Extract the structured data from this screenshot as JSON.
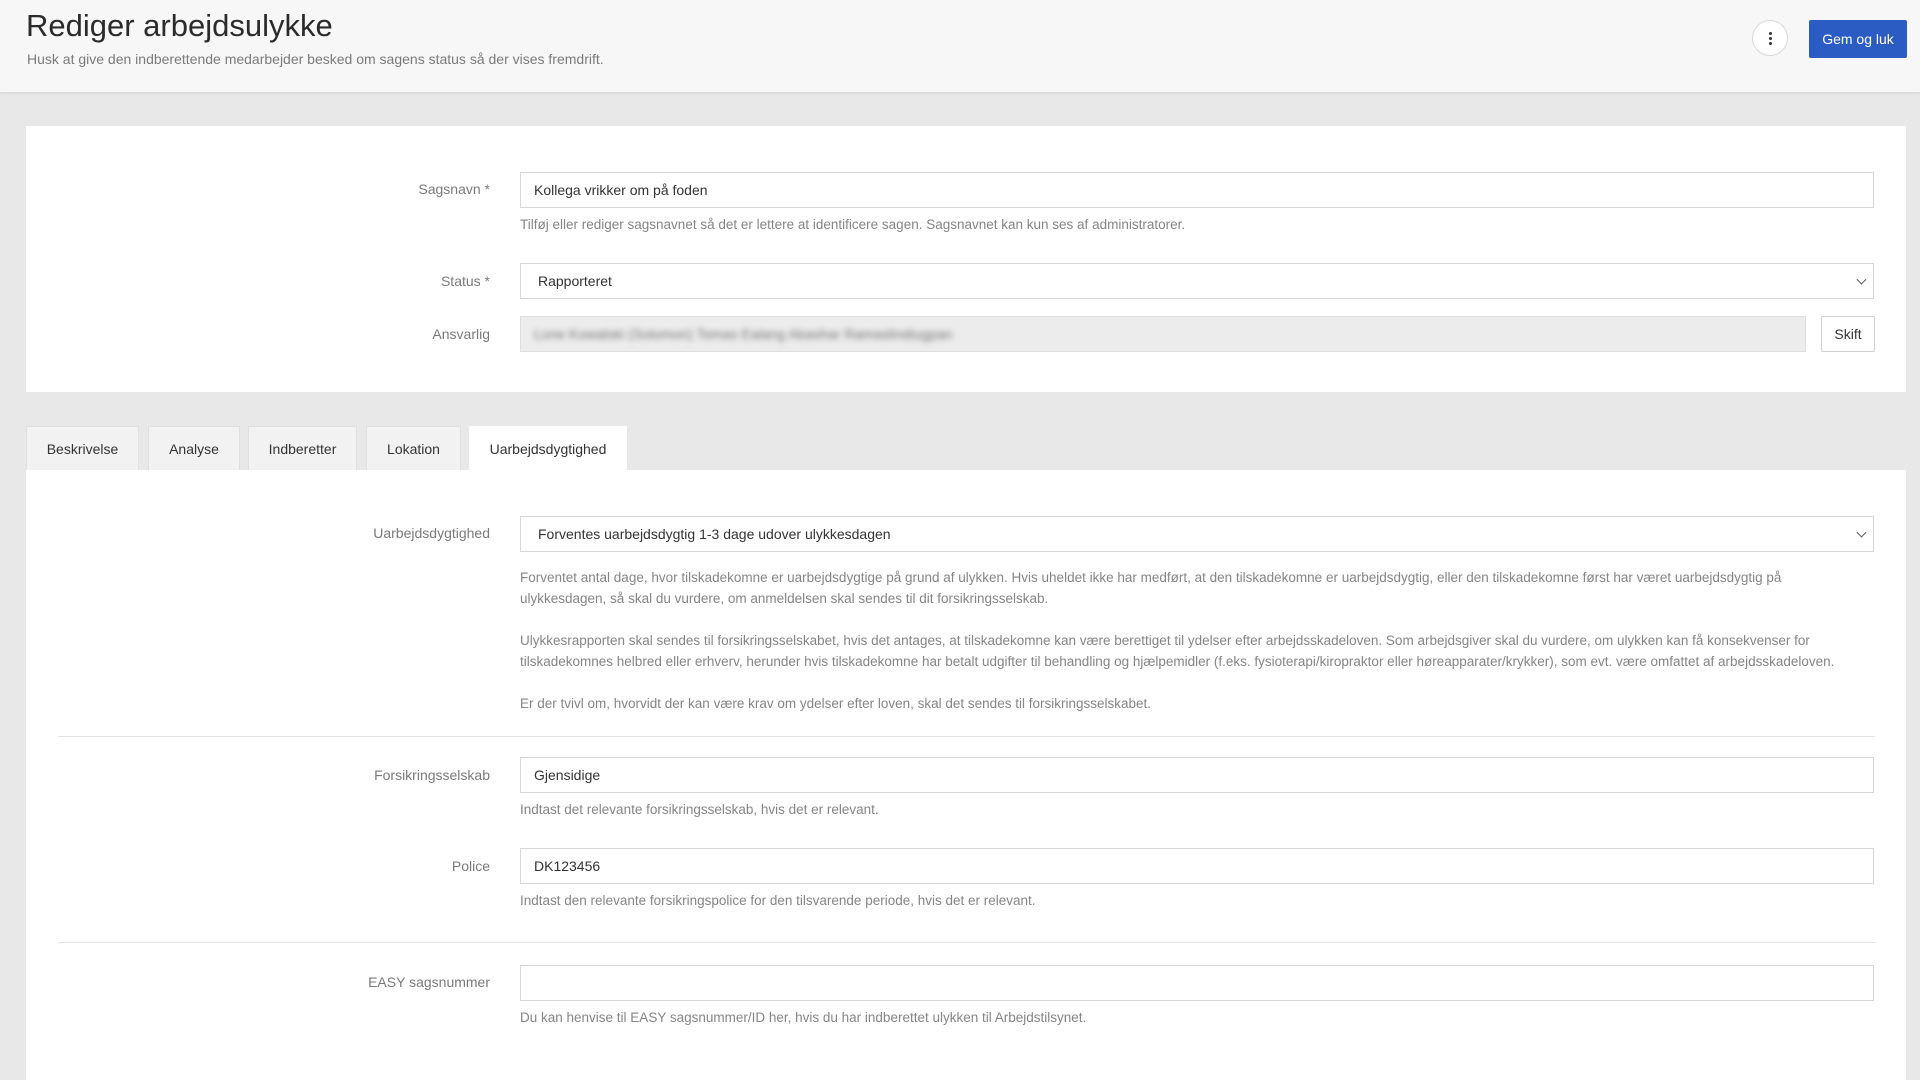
{
  "header": {
    "title": "Rediger arbejdsulykke",
    "subtitle": "Husk at give den indberettende medarbejder besked om sagens status så der vises fremdrift.",
    "save_label": "Gem og luk",
    "more_icon": "more-vertical-icon"
  },
  "case_fields": {
    "case_name": {
      "label": "Sagsnavn *",
      "value": "Kollega vrikker om på foden",
      "help": "Tilføj eller rediger sagsnavnet så det er lettere at identificere sagen. Sagsnavnet kan kun ses af administratorer."
    },
    "status": {
      "label": "Status *",
      "value": "Rapporteret"
    },
    "responsible": {
      "label": "Ansvarlig",
      "value": "Lone Kowalski (Solomon) Tomas Ealang Abashar Ramaslindiugpan",
      "button_label": "Skift"
    }
  },
  "tabs": [
    {
      "label": "Beskrivelse",
      "active": false
    },
    {
      "label": "Analyse",
      "active": false
    },
    {
      "label": "Indberetter",
      "active": false
    },
    {
      "label": "Lokation",
      "active": false
    },
    {
      "label": "Uarbejdsdygtighed",
      "active": true
    }
  ],
  "incapacity": {
    "label": "Uarbejdsdygtighed",
    "value": "Forventes uarbejdsdygtig 1-3 dage udover ulykkesdagen",
    "help_1_line1": "Forventet antal dage, hvor tilskadekomne er uarbejdsdygtige på grund af ulykken. Hvis uheldet ikke har medført, at den tilskadekomne er uarbejdsdygtig, eller den tilskadekomne først har været uarbejdsdygtig på",
    "help_1_line2": "ulykkesdagen, så skal du vurdere, om anmeldelsen skal sendes til dit forsikringsselskab.",
    "help_2_line1": "Ulykkesrapporten skal sendes til forsikringsselskabet, hvis det antages, at tilskadekomne kan være berettiget til ydelser efter arbejdsskadeloven. Som arbejdsgiver skal du vurdere, om ulykken kan få konsekvenser for",
    "help_2_line2": "tilskadekomnes helbred eller erhverv, herunder hvis tilskadekomne har betalt udgifter til behandling og hjælpemidler (f.eks. fysioterapi/kiropraktor eller høreapparater/krykker), som evt. være omfattet af arbejdsskadeloven.",
    "help_3": "Er der tvivl om, hvorvidt der kan være krav om ydelser efter loven, skal det sendes til forsikringsselskabet."
  },
  "insurance": {
    "company_label": "Forsikringsselskab",
    "company_value": "Gjensidige",
    "company_help": "Indtast det relevante forsikringsselskab, hvis det er relevant.",
    "policy_label": "Police",
    "policy_value": "DK123456",
    "policy_help": "Indtast den relevante forsikringspolice for den tilsvarende periode, hvis det er relevant."
  },
  "easy": {
    "label": "EASY sagsnummer",
    "value": "",
    "help": "Du kan henvise til EASY sagsnummer/ID her, hvis du har indberettet ulykken til Arbejdstilsynet."
  },
  "colors": {
    "primary": "#2b5cc4",
    "background": "#e8e8e8",
    "header_bg": "#f7f7f7"
  }
}
